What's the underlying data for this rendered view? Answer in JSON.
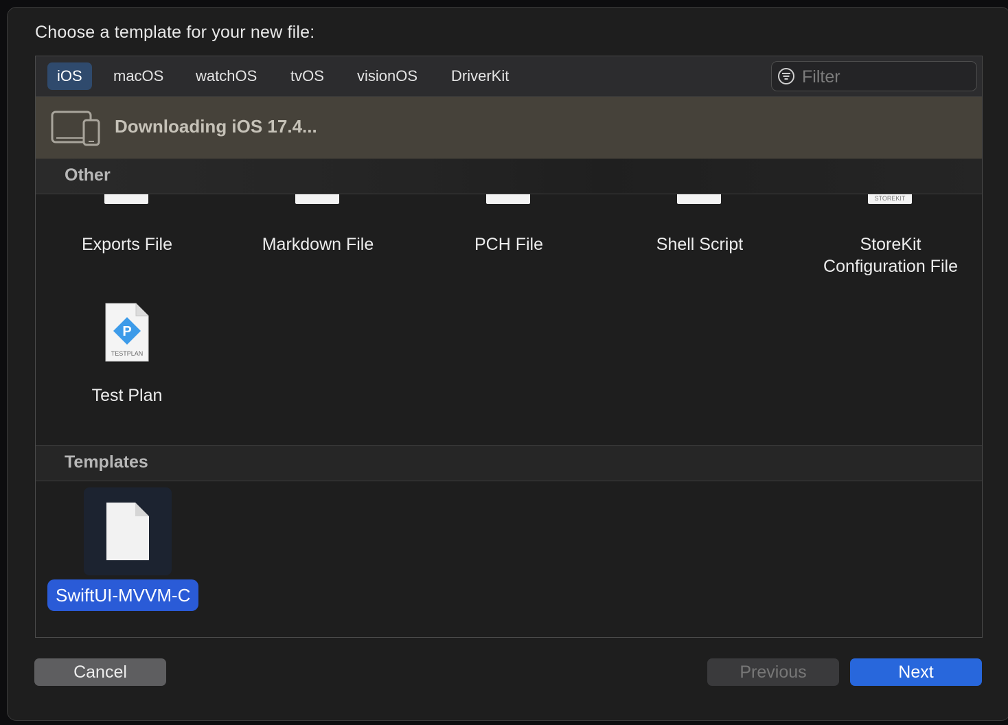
{
  "dialog": {
    "title": "Choose a template for your new file:"
  },
  "platform_tabs": [
    {
      "label": "iOS",
      "selected": true
    },
    {
      "label": "macOS",
      "selected": false
    },
    {
      "label": "watchOS",
      "selected": false
    },
    {
      "label": "tvOS",
      "selected": false
    },
    {
      "label": "visionOS",
      "selected": false
    },
    {
      "label": "DriverKit",
      "selected": false
    }
  ],
  "filter": {
    "placeholder": "Filter",
    "icon": "filter-icon"
  },
  "download_banner": {
    "text": "Downloading iOS 17.4...",
    "icon": "devices-icon"
  },
  "sections": {
    "other": {
      "title": "Other",
      "items": [
        {
          "label": "Exports File",
          "icon": "exports-file-icon"
        },
        {
          "label": "Markdown File",
          "icon": "markdown-file-icon"
        },
        {
          "label": "PCH File",
          "icon": "pch-file-icon"
        },
        {
          "label": "Shell Script",
          "icon": "shell-script-icon"
        },
        {
          "label": "StoreKit Configuration File",
          "icon": "storekit-file-icon",
          "icon_text": "STOREKIT"
        },
        {
          "label": "Test Plan",
          "icon": "test-plan-icon",
          "icon_text": "TESTPLAN"
        }
      ]
    },
    "templates": {
      "title": "Templates",
      "items": [
        {
          "label": "SwiftUI-MVVM-C",
          "icon": "blank-document-icon",
          "selected": true
        }
      ]
    }
  },
  "buttons": {
    "cancel": "Cancel",
    "previous": "Previous",
    "next": "Next"
  },
  "colors": {
    "accent": "#2a5bd7",
    "selected_tab": "#2f4a6d",
    "banner_bg": "#46423a",
    "testplan_diamond": "#3d9be9"
  }
}
